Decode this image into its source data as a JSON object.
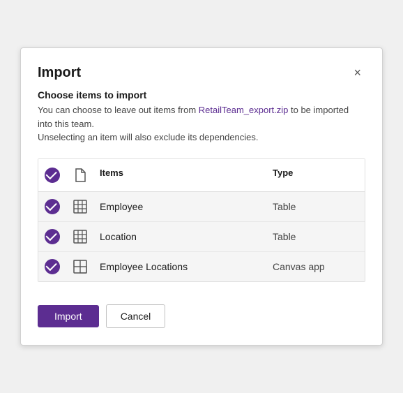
{
  "dialog": {
    "title": "Import",
    "close_label": "×",
    "subtitle": "Choose items to import",
    "description_part1": "You can choose to leave out items from ",
    "description_file": "RetailTeam_export.zip",
    "description_part2": " to be imported into this team.",
    "description_line2": "Unselecting an item will also exclude its dependencies.",
    "table": {
      "col_items": "Items",
      "col_type": "Type",
      "rows": [
        {
          "name": "Employee",
          "type": "Table",
          "icon": "table",
          "checked": true
        },
        {
          "name": "Location",
          "type": "Table",
          "icon": "table",
          "checked": true
        },
        {
          "name": "Employee Locations",
          "type": "Canvas app",
          "icon": "canvas",
          "checked": true
        }
      ]
    },
    "buttons": {
      "import": "Import",
      "cancel": "Cancel"
    }
  }
}
